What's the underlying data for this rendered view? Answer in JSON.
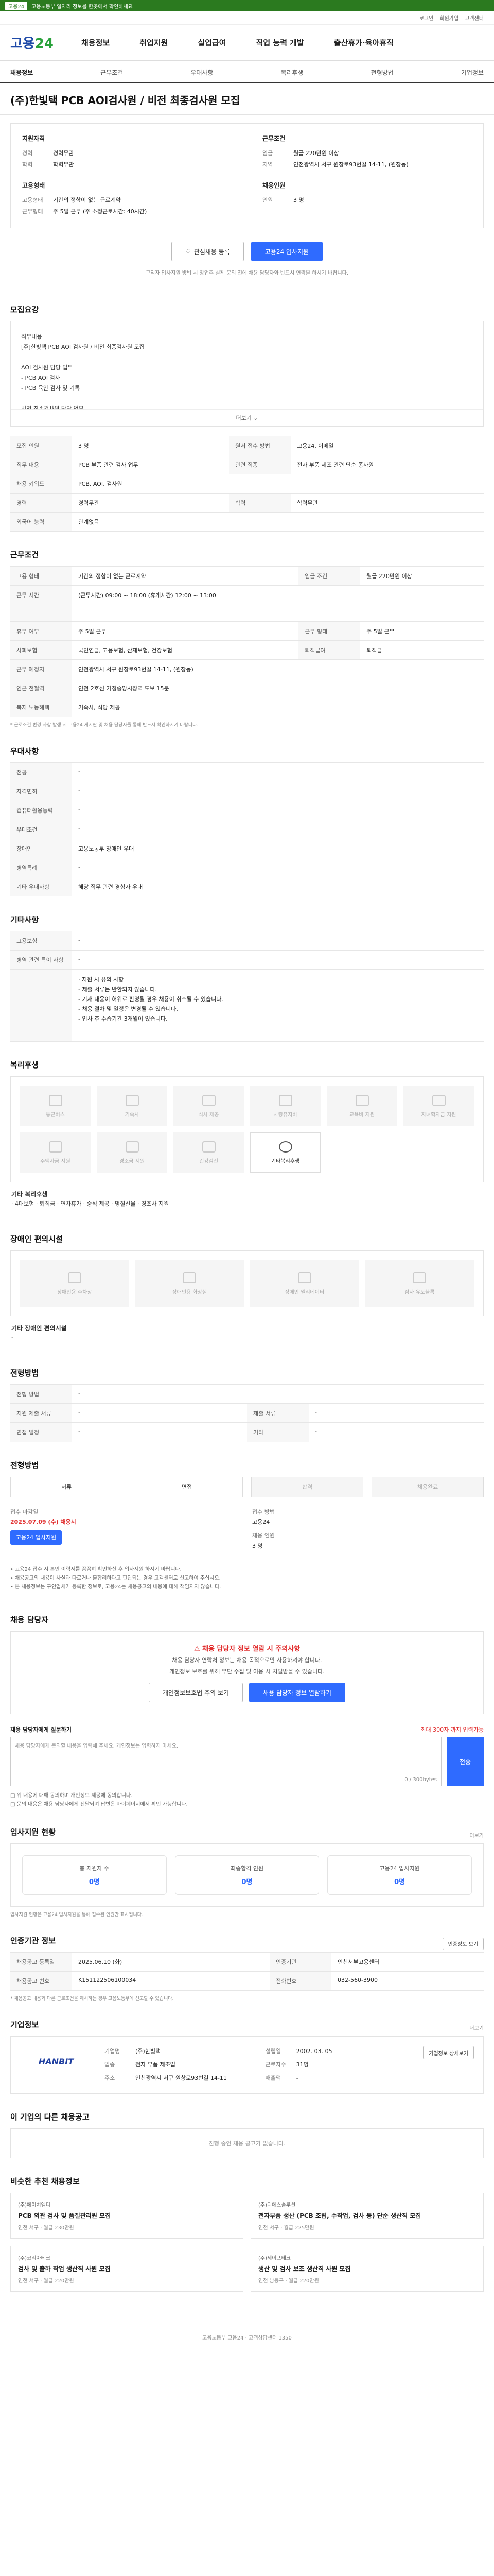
{
  "promo": {
    "badge": "고용24",
    "text": "고용노동부 일자리 정보를 한곳에서 확인하세요"
  },
  "util": [
    "로그인",
    "회원가입",
    "고객센터"
  ],
  "header": {
    "logo_main": "고용",
    "logo_num": "24",
    "gnb": [
      "채용정보",
      "취업지원",
      "실업급여",
      "직업 능력 개발",
      "출산휴가·육아휴직"
    ]
  },
  "subnav": [
    "채용정보",
    "근무조건",
    "우대사항",
    "복리후생",
    "전형방법",
    "기업정보"
  ],
  "job": {
    "title": "(주)한빛택 PCB AOI검사원 / 비전 최종검사원 모집"
  },
  "summary": {
    "col1_title": "지원자격",
    "col1": [
      {
        "k": "경력",
        "v": "경력무관"
      },
      {
        "k": "학력",
        "v": "학력무관"
      }
    ],
    "col2_title": "근무조건",
    "col2": [
      {
        "k": "임금",
        "v": "월급 220만원 이상"
      },
      {
        "k": "지역",
        "v": "인천광역시 서구 원창로93번길 14-11, (원창동)"
      }
    ],
    "col3_title": "고용형태",
    "col3": [
      {
        "k": "고용형태",
        "v": "기간의 정함이 없는 근로계약"
      },
      {
        "k": "근무형태",
        "v": "주 5일 근무 (주 소정근로시간: 40시간)"
      }
    ],
    "col4_title": "채용인원",
    "col4": [
      {
        "k": "인원",
        "v": "3 명"
      }
    ],
    "btn_scrap": "관심채용 등록",
    "btn_apply": "고용24 입사지원",
    "notice": "구직자 입사지원 방법 시 창업주 실제 문의 전에 채용 담당자와 반드시 연락을 하시기 바랍니다."
  },
  "recruit": {
    "title": "모집요강",
    "desc": "직무내용\n[주]한빛택 PCB AOI 검사원 / 비전 최종검사원 모집\n\nAOI 검사원 담당 업무\n - PCB AOI 검사\n - PCB 육안 검사 및 기록\n\n비전 최종검사원 담당 업무\n - 완성제품 비전검사 및 판정\n - 제품 외관 검사 및 기록",
    "more": "더보기",
    "rows": [
      [
        "모집 인원",
        "3 명",
        "원서 접수 방법",
        "고용24, 이메일"
      ],
      [
        "직무 내용",
        "PCB 부품 관련 검사 업무",
        "관련 직종",
        "전자 부품 제조 관련 단순 종사원"
      ],
      [
        "채용 키워드",
        "PCB, AOI, 검사원",
        "",
        ""
      ],
      [
        "경력",
        "경력무관",
        "학력",
        "학력무관"
      ],
      [
        "외국어 능력",
        "관계없음",
        "",
        ""
      ]
    ]
  },
  "condition": {
    "title": "근무조건",
    "rows": [
      [
        "고용 형태",
        "기간의 정함이 없는 근로계약",
        "임금 조건",
        "월급 220만원 이상"
      ],
      [
        "근무 시간",
        "(근무시간) 09:00 ~ 18:00 (휴게시간) 12:00 ~ 13:00",
        "",
        ""
      ],
      [
        "휴무 여부",
        "주 5일 근무",
        "근무 형태",
        "주 5일 근무"
      ],
      [
        "사회보험",
        "국민연금, 고용보험, 산재보험, 건강보험",
        "퇴직급여",
        "퇴직금"
      ],
      [
        "근무 예정지",
        "인천광역시 서구 원창로93번길 14-11, (원창동)",
        "",
        ""
      ],
      [
        "인근 전철역",
        "인천 2호선 가정중앙시장역 도보 15분",
        "",
        ""
      ],
      [
        "복지 노동혜택",
        "기숙사, 식당 제공",
        "",
        ""
      ]
    ],
    "footnote": "* 근로조건 변경 사항 발생 시 고용24 게시판 및 채용 담당자를 통해 반드시 확인하시기 바랍니다."
  },
  "prefer": {
    "title": "우대사항",
    "rows": [
      [
        "전공",
        "-"
      ],
      [
        "자격면허",
        "-"
      ],
      [
        "컴퓨터활용능력",
        "-"
      ],
      [
        "우대조건",
        "-"
      ],
      [
        "장애인",
        "고용노동부 장애인 우대"
      ],
      [
        "병역특례",
        "-"
      ],
      [
        "기타 우대사항",
        "해당 직무 관련 경험자 우대"
      ]
    ]
  },
  "etc": {
    "title": "기타사항",
    "rows": [
      [
        "고용보험",
        "-"
      ],
      [
        "병역 관련 특이 사항",
        "-"
      ]
    ],
    "notes": "· 지원 시 유의 사항\n - 제출 서류는 반환되지 않습니다.\n - 기재 내용이 허위로 판명될 경우 채용이 취소될 수 있습니다.\n - 채용 절차 및 일정은 변경될 수 있습니다.\n - 입사 후 수습기간 3개월이 있습니다."
  },
  "welfare": {
    "title": "복리후생",
    "items": [
      "통근버스",
      "기숙사",
      "식사 제공",
      "차량유지비",
      "교육비 지원",
      "자녀학자금 지원",
      "주택자금 지원",
      "경조금 지원",
      "건강검진",
      "기타복리후생"
    ],
    "detail_title": "기타 복리후생",
    "detail": "· 4대보험 · 퇴직금 · 연차휴가 · 중식 제공 · 명절선물 · 경조사 지원"
  },
  "disabled": {
    "title": "장애인 편의시설",
    "items": [
      "장애인용 주차장",
      "장애인용 화장실",
      "장애인 엘리베이터",
      "점자 유도블록"
    ],
    "detail_title": "기타 장애인 편의시설",
    "detail": "-"
  },
  "process": {
    "title": "전형방법",
    "rows": [
      [
        "전형 방법",
        "-",
        "",
        ""
      ],
      [
        "지원 제출 서류",
        "-",
        "제출 서류",
        "-"
      ],
      [
        "면접 일정",
        "-",
        "기타",
        "-"
      ]
    ]
  },
  "status": {
    "title": "전형방법",
    "steps": [
      "서류",
      "면접",
      "합격",
      "채용완료"
    ],
    "start_label": "접수 마감일",
    "deadline": "2025.07.09 (수) 채용시",
    "recv_label": "접수 방법",
    "recv": "고용24",
    "recv2_label": "채용 인원",
    "recv2": "3 명",
    "apply_btn": "고용24 입사지원",
    "bullets": "• 고용24 접수 시 본인 이력서를 꼼꼼히 확인하신 후 입사지원 하시기 바랍니다.\n• 채용공고의 내용이 사실과 다르거나 불합리하다고 판단되는 경우 고객센터로 신고하여 주십시오.\n• 본 채용정보는 구인업체가 등록한 정보로, 고용24는 채용공고의 내용에 대해 책임지지 않습니다."
  },
  "manager": {
    "title": "채용 담당자",
    "warn": "채용 담당자 정보 열람 시 주의사항",
    "p1": "채용 담당자 연락처 정보는 채용 목적으로만 사용하셔야 합니다.",
    "p2": "개인정보 보호를 위해 무단 수집 및 이용 시 처벌받을 수 있습니다.",
    "btn1": "개인정보보호법 주의 보기",
    "btn2": "채용 담당자 정보 열람하기",
    "inq_title": "채용 담당자에게 질문하기",
    "inq_right": "최대 300자 까지 입력가능",
    "inq_placeholder": "채용 담당자에게 문의할 내용을 입력해 주세요. 개인정보는 입력하지 마세요.",
    "inq_count": "0 / 300bytes",
    "inq_send": "전송",
    "check": "□ 위 내용에 대해 동의하며 개인정보 제공에 동의합니다.\n□ 문의 내용은 채용 담당자에게 전달되며 답변은 마이페이지에서 확인 가능합니다."
  },
  "applicants": {
    "title": "입사지원 현황",
    "more": "더보기",
    "items": [
      {
        "t": "총 지원자 수",
        "n": "0명"
      },
      {
        "t": "최종합격 인원",
        "n": "0명"
      },
      {
        "t": "고용24 입사지원",
        "n": "0명"
      }
    ],
    "note": "입사지원 현황은 고용24 입사지원을 통해 접수된 인원만 표시됩니다."
  },
  "info": {
    "title": "인증기관 정보",
    "btn": "인증정보 보기",
    "rows": [
      [
        "채용공고 등록일",
        "2025.06.10 (화)",
        "인증기관",
        "인천서부고용센터"
      ],
      [
        "채용공고 번호",
        "K151122506100034",
        "전화번호",
        "032-560-3900"
      ]
    ],
    "note": "* 채용공고 내용과 다른 근로조건을 제시하는 경우 고용노동부에 신고할 수 있습니다."
  },
  "company": {
    "title": "기업정보",
    "more": "더보기",
    "logo": "HANBIT",
    "rows": [
      [
        "기업명",
        "(주)한빛택",
        "설립일",
        "2002. 03. 05"
      ],
      [
        "업종",
        "전자 부품 제조업",
        "근로자수",
        "31명"
      ],
      [
        "주소",
        "인천광역시 서구 원창로93번길 14-11",
        "매출액",
        "-"
      ]
    ],
    "btn": "기업정보 상세보기"
  },
  "others": {
    "title": "이 기업의 다른 채용공고",
    "empty": "진행 중인 채용 공고가 없습니다."
  },
  "recommend": {
    "title": "비슷한 추천 채용정보",
    "items": [
      {
        "co": "(주)에이치엠디",
        "t": "PCB 외관 검사 및 품질관리원 모집",
        "meta": "인천 서구 · 월급 230만원"
      },
      {
        "co": "(주)디에스솔루션",
        "t": "전자부품 생산 (PCB 조립, 수작업, 검사 등) 단순 생산직 모집",
        "meta": "인천 서구 · 월급 225만원"
      },
      {
        "co": "(주)코리아테크",
        "t": "검사 및 출하 작업 생산직 사원 모집",
        "meta": "인천 서구 · 월급 220만원"
      },
      {
        "co": "(주)세이프테크",
        "t": "생산 및 검사 보조 생산직 사원 모집",
        "meta": "인천 남동구 · 월급 220만원"
      }
    ]
  },
  "footer": {
    "text": "고용노동부 고용24 · 고객상담센터 1350"
  }
}
